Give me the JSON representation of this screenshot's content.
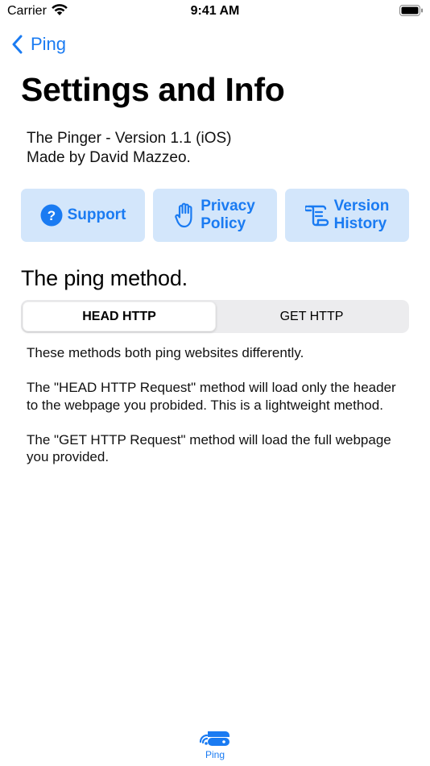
{
  "status_bar": {
    "carrier": "Carrier",
    "time": "9:41 AM"
  },
  "nav": {
    "back_label": "Ping"
  },
  "page": {
    "title": "Settings and Info"
  },
  "info": {
    "line1": "The Pinger - Version 1.1 (iOS)",
    "line2": "Made by David Mazzeo."
  },
  "actions": [
    {
      "icon": "question-circle-icon",
      "line1": "Support",
      "line2": ""
    },
    {
      "icon": "hand-raised-icon",
      "line1": "Privacy",
      "line2": "Policy"
    },
    {
      "icon": "scroll-icon",
      "line1": "Version",
      "line2": "History"
    }
  ],
  "section": {
    "title": "The ping method."
  },
  "segmented": {
    "options": [
      "HEAD HTTP",
      "GET HTTP"
    ],
    "selected": "HEAD HTTP"
  },
  "description": {
    "p1": "These methods both ping websites differently.",
    "p2": "The \"HEAD HTTP Request\" method will load only the header to the webpage you probided. This is a lightweight method.",
    "p3": "The \"GET HTTP Request\" method will load the full webpage you provided."
  },
  "tab_bar": {
    "items": [
      {
        "label": "Ping",
        "icon": "router-wifi-icon",
        "selected": true
      }
    ]
  },
  "colors": {
    "accent": "#1a7bf2",
    "button_bg": "#d3e6fb",
    "segment_bg": "#ececee"
  }
}
